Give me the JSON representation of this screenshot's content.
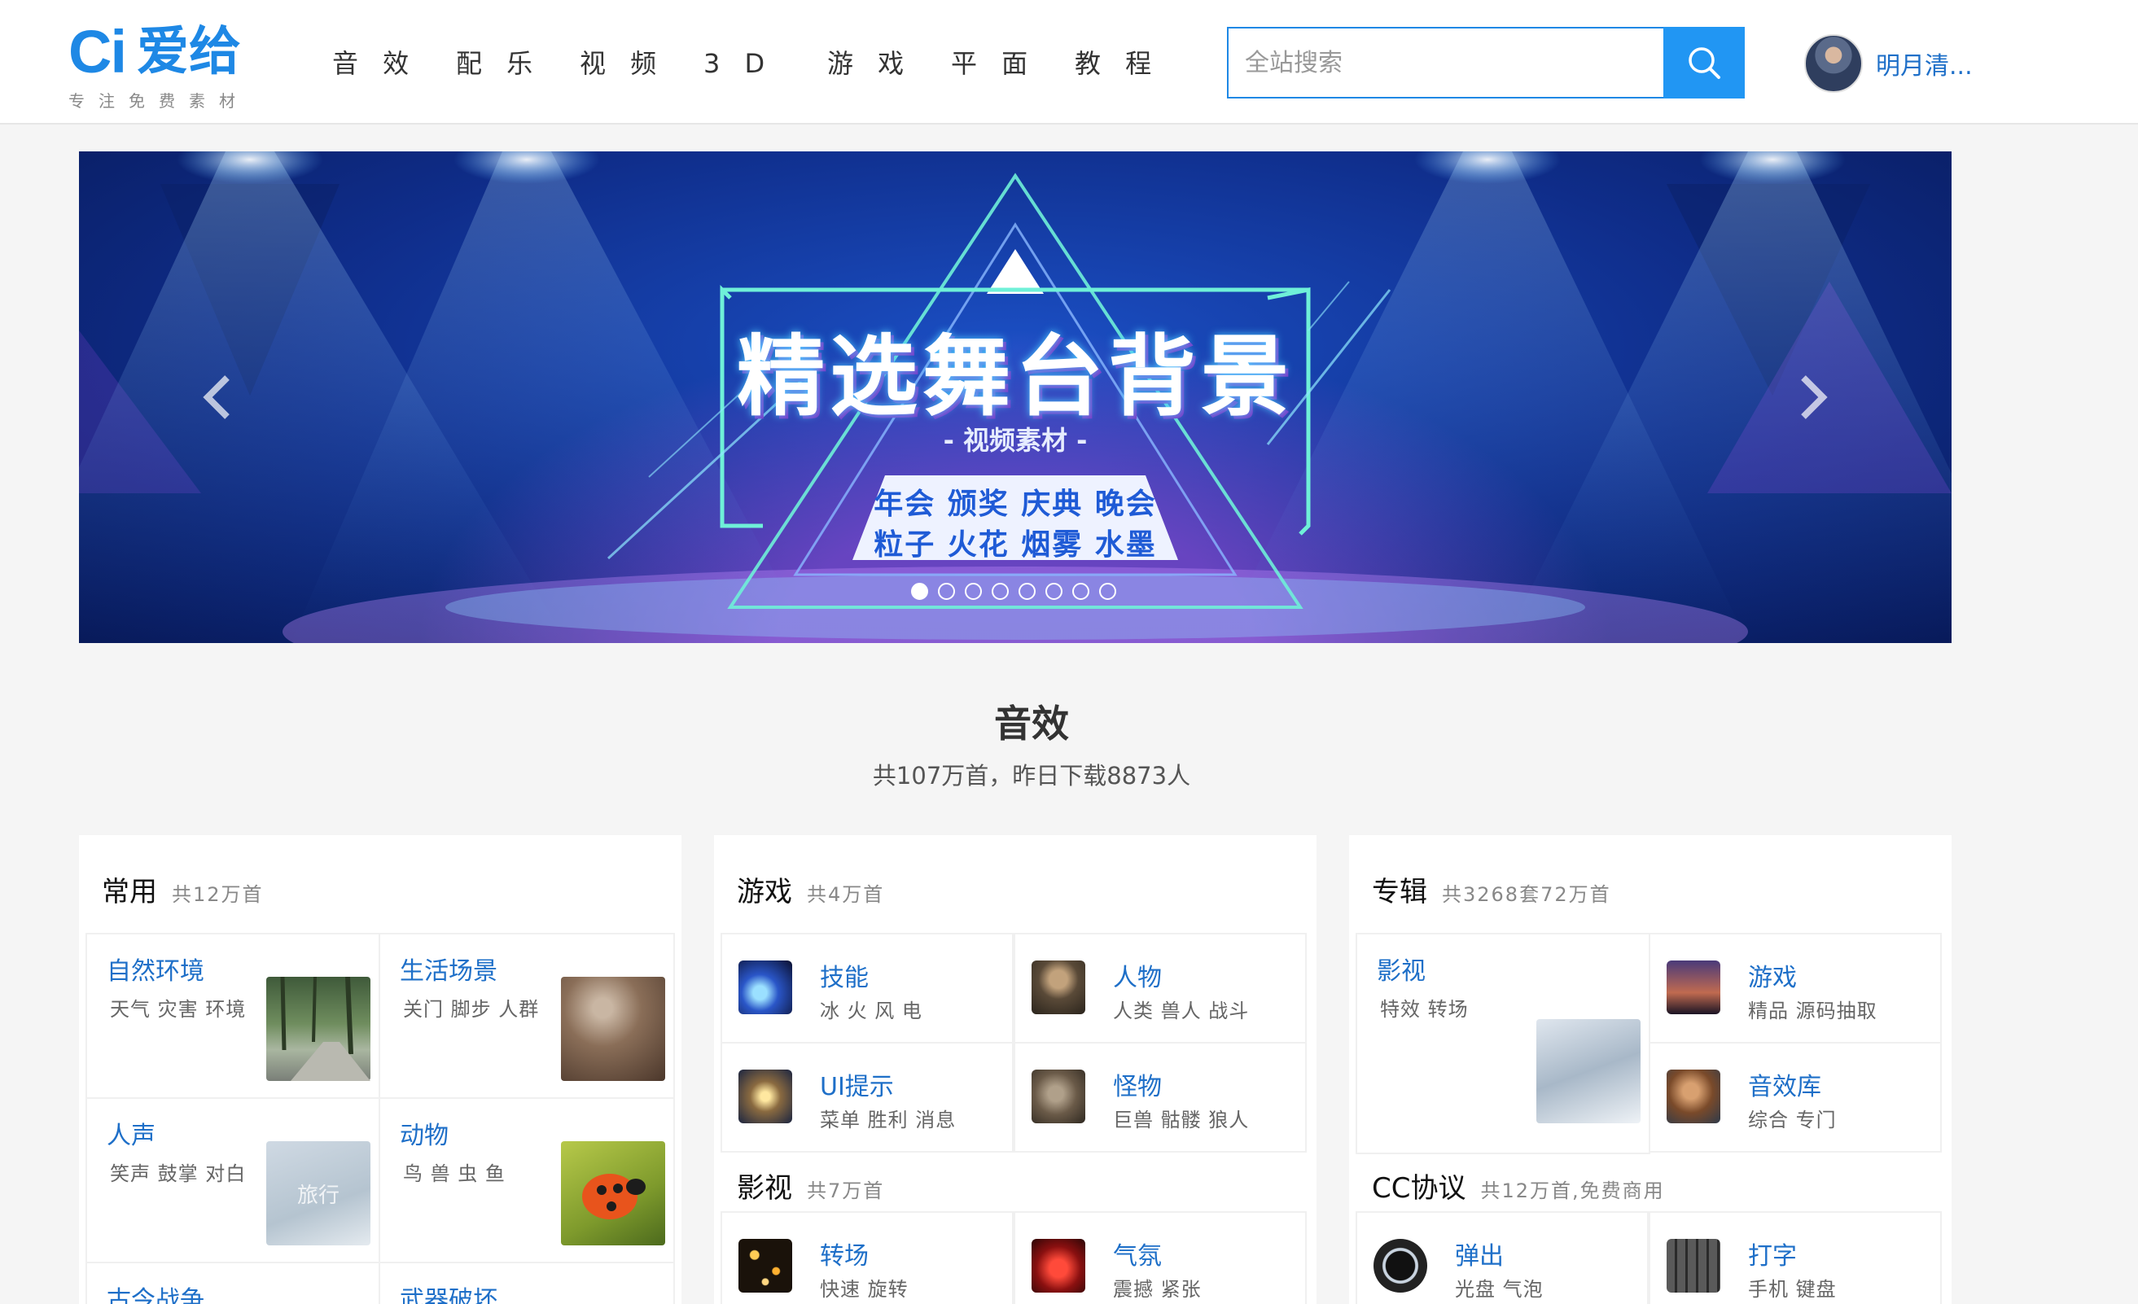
{
  "header": {
    "logo_mark": "Ci",
    "logo_name": "爱给",
    "logo_tagline": "专注免费素材",
    "nav": [
      "音 效",
      "配 乐",
      "视 频",
      "3 D",
      "游 戏",
      "平 面",
      "教 程"
    ],
    "search_placeholder": "全站搜索",
    "user_name": "明月清..."
  },
  "banner": {
    "title": "精选舞台背景",
    "subtitle": "- 视频素材 -",
    "line1": "年会 颁奖 庆典 晚会",
    "line2": "粒子 火花 烟雾 水墨",
    "prev_icon": "chevron-left-icon",
    "next_icon": "chevron-right-icon",
    "slides": 8,
    "active_slide": 1
  },
  "section": {
    "title": "音效",
    "subtitle": "共107万首，昨日下载8873人"
  },
  "cards": {
    "common": {
      "title": "常用",
      "count": "共12万首",
      "tiles": [
        {
          "title": "自然环境",
          "tags": "天气 灾害 环境"
        },
        {
          "title": "生活场景",
          "tags": "关门 脚步 人群"
        },
        {
          "title": "人声",
          "tags": "笑声 鼓掌 对白",
          "thumb_text": "旅行"
        },
        {
          "title": "动物",
          "tags": "鸟 兽 虫 鱼"
        },
        {
          "title": "古今战争"
        },
        {
          "title": "武器破坏"
        }
      ]
    },
    "game": {
      "title": "游戏",
      "count": "共4万首",
      "items": [
        {
          "title": "技能",
          "tags": "冰 火 风 电"
        },
        {
          "title": "人物",
          "tags": "人类 兽人 战斗"
        },
        {
          "title": "UI提示",
          "tags": "菜单 胜利 消息"
        },
        {
          "title": "怪物",
          "tags": "巨兽 骷髅 狼人"
        }
      ],
      "sub_title": "影视",
      "sub_count": "共7万首",
      "sub_items": [
        {
          "title": "转场",
          "tags": "快速 旋转"
        },
        {
          "title": "气氛",
          "tags": "震撼 紧张"
        }
      ]
    },
    "album": {
      "title": "专辑",
      "count": "共3268套72万首",
      "big_tile": {
        "title": "影视",
        "tags": "特效 转场"
      },
      "items": [
        {
          "title": "游戏",
          "tags": "精品 源码抽取"
        },
        {
          "title": "音效库",
          "tags": "综合 专门"
        }
      ],
      "sub_title": "CC协议",
      "sub_count": "共12万首,免费商用",
      "sub_items": [
        {
          "title": "弹出",
          "tags": "光盘 气泡"
        },
        {
          "title": "打字",
          "tags": "手机 键盘"
        }
      ]
    }
  },
  "colors": {
    "accent": "#2196f3",
    "link": "#1e6fc8"
  }
}
